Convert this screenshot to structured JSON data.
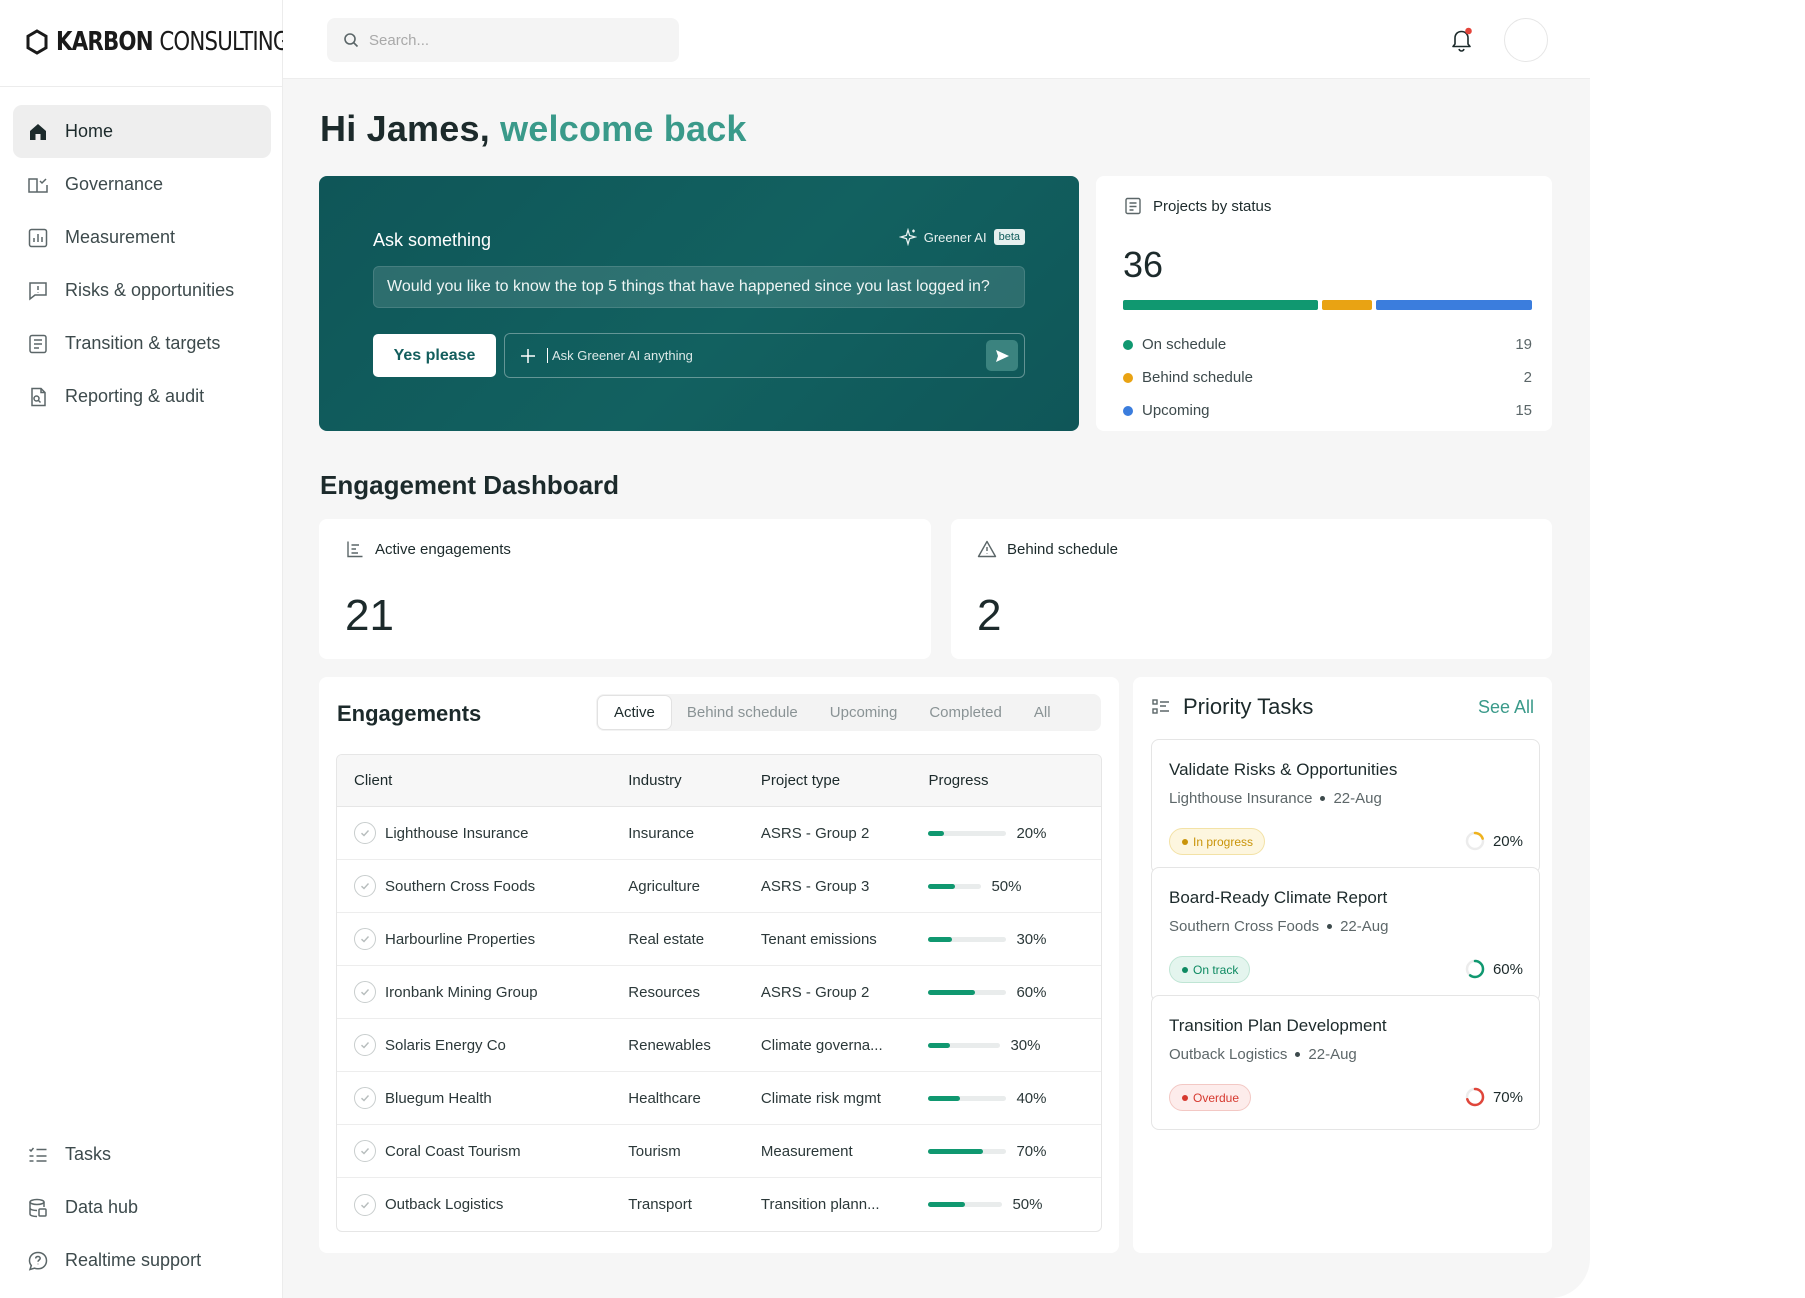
{
  "brand": {
    "name_bold": "KARBON",
    "name_light": "CONSULTING"
  },
  "sidebar": {
    "items": [
      {
        "label": "Home",
        "icon": "home-icon",
        "active": true
      },
      {
        "label": "Governance",
        "icon": "book-check-icon"
      },
      {
        "label": "Measurement",
        "icon": "bar-chart-icon"
      },
      {
        "label": "Risks & opportunities",
        "icon": "message-alert-icon"
      },
      {
        "label": "Transition & targets",
        "icon": "document-list-icon"
      },
      {
        "label": "Reporting & audit",
        "icon": "file-search-icon"
      }
    ],
    "bottom_items": [
      {
        "label": "Tasks",
        "icon": "task-list-icon"
      },
      {
        "label": "Data hub",
        "icon": "database-icon"
      },
      {
        "label": "Realtime support",
        "icon": "help-chat-icon"
      }
    ]
  },
  "topbar": {
    "search_placeholder": "Search..."
  },
  "greeting": {
    "prefix": "Hi James,",
    "accent": "welcome back"
  },
  "ai": {
    "title": "Ask something",
    "brand": "Greener AI",
    "badge": "beta",
    "question": "Would you like to know the top 5 things that have happened since you last logged in?",
    "yes_label": "Yes please",
    "input_placeholder": "Ask Greener AI anything"
  },
  "projects": {
    "title": "Projects by status",
    "total": "36",
    "statuses": [
      {
        "label": "On schedule",
        "count": "19",
        "value": 19,
        "color": "#109870"
      },
      {
        "label": "Behind schedule",
        "count": "2",
        "value": 2,
        "color": "#e9a313"
      },
      {
        "label": "Upcoming",
        "count": "15",
        "value": 15,
        "color": "#3b7ddd"
      }
    ]
  },
  "dashboard": {
    "title": "Engagement Dashboard",
    "kpis": [
      {
        "label": "Active engagements",
        "value": "21"
      },
      {
        "label": "Behind schedule",
        "value": "2"
      }
    ]
  },
  "engagements": {
    "title": "Engagements",
    "tabs": [
      "Active",
      "Behind schedule",
      "Upcoming",
      "Completed",
      "All"
    ],
    "active_tab": "Active",
    "columns": [
      "Client",
      "Industry",
      "Project type",
      "Progress"
    ],
    "rows": [
      {
        "client": "Lighthouse Insurance",
        "industry": "Insurance",
        "type": "ASRS - Group 2",
        "progress": 20,
        "pct": "20%"
      },
      {
        "client": "Southern Cross Foods",
        "industry": "Agriculture",
        "type": "ASRS - Group 3",
        "progress": 50,
        "pct": "50%"
      },
      {
        "client": "Harbourline Properties",
        "industry": "Real estate",
        "type": "Tenant emissions",
        "progress": 30,
        "pct": "30%"
      },
      {
        "client": "Ironbank Mining Group",
        "industry": "Resources",
        "type": "ASRS - Group 2",
        "progress": 60,
        "pct": "60%"
      },
      {
        "client": "Solaris Energy Co",
        "industry": "Renewables",
        "type": "Climate governa...",
        "progress": 30,
        "pct": "30%"
      },
      {
        "client": "Bluegum Health",
        "industry": "Healthcare",
        "type": "Climate risk mgmt",
        "progress": 40,
        "pct": "40%"
      },
      {
        "client": "Coral Coast Tourism",
        "industry": "Tourism",
        "type": "Measurement",
        "progress": 70,
        "pct": "70%"
      },
      {
        "client": "Outback Logistics",
        "industry": "Transport",
        "type": "Transition plann...",
        "progress": 50,
        "pct": "50%"
      }
    ]
  },
  "tasks": {
    "title": "Priority Tasks",
    "see_all": "See All",
    "items": [
      {
        "title": "Validate Risks & Opportunities",
        "client": "Lighthouse Insurance",
        "date": "22-Aug",
        "status": "In progress",
        "status_color": "#c9940a",
        "status_bg": "#fdf6df",
        "status_border": "#f3e2a6",
        "progress": 20,
        "pct": "20%",
        "ring_color": "#efb21d"
      },
      {
        "title": "Board-Ready Climate Report",
        "client": "Southern Cross Foods",
        "date": "22-Aug",
        "status": "On track",
        "status_color": "#0e8a62",
        "status_bg": "#e4f5ee",
        "status_border": "#bfe5d4",
        "progress": 60,
        "pct": "60%",
        "ring_color": "#109870"
      },
      {
        "title": "Transition Plan Development",
        "client": "Outback Logistics",
        "date": "22-Aug",
        "status": "Overdue",
        "status_color": "#d6392f",
        "status_bg": "#fdeceb",
        "status_border": "#f3c8c4",
        "progress": 70,
        "pct": "70%",
        "ring_color": "#e0463b"
      }
    ]
  }
}
